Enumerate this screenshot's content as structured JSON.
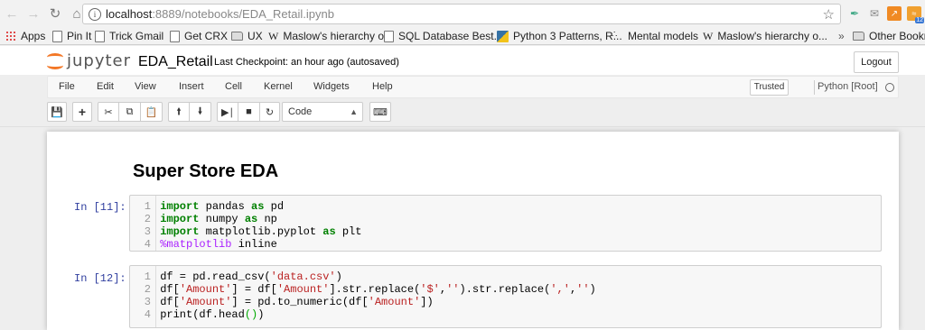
{
  "browser": {
    "url_host": "localhost",
    "url_path": ":8889/notebooks/EDA_Retail.ipynb",
    "bookmarks": [
      {
        "label": "Apps",
        "icon": "apps-grid-icon"
      },
      {
        "label": "Pin It",
        "icon": "page-icon"
      },
      {
        "label": "Trick Gmail",
        "icon": "page-icon"
      },
      {
        "label": "Get CRX",
        "icon": "page-icon"
      },
      {
        "label": "UX",
        "icon": "folder-icon"
      },
      {
        "label": "Maslow's hierarchy o...",
        "icon": "wikipedia-icon"
      },
      {
        "label": "SQL Database Best...",
        "icon": "page-icon"
      },
      {
        "label": "Python 3 Patterns, R...",
        "icon": "python-icon"
      },
      {
        "label": "Mental models",
        "icon": "dots-icon"
      },
      {
        "label": "Maslow's hierarchy o...",
        "icon": "wikipedia-icon"
      }
    ],
    "bookmarks_overflow": "»",
    "other_bookmarks": "Other Bookm",
    "extension_badge": "12"
  },
  "jupyter": {
    "logo_text": "jupyter",
    "notebook_name": "EDA_Retail",
    "checkpoint": "Last Checkpoint: an hour ago (autosaved)",
    "logout": "Logout",
    "menu": [
      "File",
      "Edit",
      "View",
      "Insert",
      "Cell",
      "Kernel",
      "Widgets",
      "Help"
    ],
    "trusted": "Trusted",
    "kernel": "Python [Root]",
    "cell_type": "Code"
  },
  "cells": {
    "heading": "Super Store EDA",
    "cell1_prompt": "In [11]:",
    "cell2_prompt": "In [12]:",
    "cell1_lines": [
      {
        "n": "1",
        "text": "import pandas as pd"
      },
      {
        "n": "2",
        "text": "import numpy as np"
      },
      {
        "n": "3",
        "text": "import matplotlib.pyplot as plt"
      },
      {
        "n": "4",
        "text": "%matplotlib inline"
      }
    ],
    "cell2_lines": [
      {
        "n": "1",
        "text": "df = pd.read_csv('data.csv')"
      },
      {
        "n": "2",
        "text": "df['Amount'] = df['Amount'].str.replace('$','').str.replace(',','')"
      },
      {
        "n": "3",
        "text": "df['Amount'] = pd.to_numeric(df['Amount'])"
      },
      {
        "n": "4",
        "text": "print(df.head())"
      }
    ]
  }
}
